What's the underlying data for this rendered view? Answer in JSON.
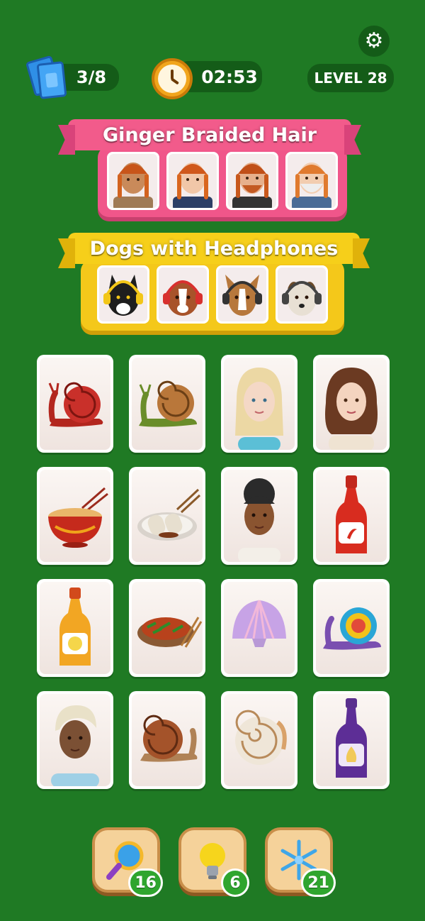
{
  "header": {
    "cards_count": "3/8",
    "timer": "02:53",
    "level_label": "LEVEL 28"
  },
  "icons": {
    "settings": "gear-icon",
    "cards": "cards-icon",
    "timer": "stopwatch-icon",
    "magnifier": "magnifier-icon",
    "hint": "lightbulb-icon",
    "freeze": "snowflake-icon"
  },
  "groups": [
    {
      "title": "Ginger Braided Hair",
      "color": "#f25b8b",
      "items": [
        "woman-braids-1",
        "woman-braids-2",
        "man-braids-beard",
        "old-man-braids"
      ]
    },
    {
      "title": "Dogs with Headphones",
      "color": "#f6cf1a",
      "items": [
        "black-dog-headphones",
        "brown-dog-headphones",
        "terrier-headphones",
        "wire-dog-headphones"
      ]
    }
  ],
  "board": [
    [
      "red-snail",
      "green-snail",
      "blonde-woman",
      "brunette-woman"
    ],
    [
      "noodle-bowl",
      "spring-rolls",
      "curly-woman",
      "hot-sauce-bottle"
    ],
    [
      "lemon-sauce-bottle",
      "stir-fry-plate",
      "pearl-shell",
      "rainbow-snail"
    ],
    [
      "grey-haired-woman",
      "brown-snail",
      "spiral-shell",
      "garlic-sauce-bottle"
    ]
  ],
  "boosters": [
    {
      "name": "magnifier",
      "count": "16"
    },
    {
      "name": "hint",
      "count": "6"
    },
    {
      "name": "freeze",
      "count": "21"
    }
  ],
  "colors": {
    "background": "#1f7a24",
    "pill": "#145c18",
    "pink": "#f25b8b",
    "yellow": "#f6cf1a",
    "badge": "#2fa52e"
  }
}
